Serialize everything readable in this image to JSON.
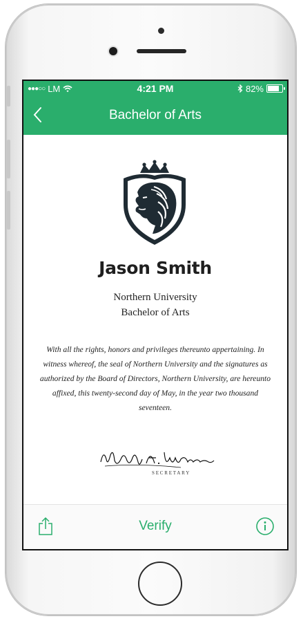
{
  "status_bar": {
    "carrier": "LM",
    "signal_dots": "●●●○○",
    "time": "4:21 PM",
    "battery_percent": "82%",
    "battery_level": 0.82
  },
  "nav": {
    "title": "Bachelor of Arts",
    "back_icon": "chevron-left-icon"
  },
  "certificate": {
    "crest_icon": "lion-shield-crest-icon",
    "recipient_name": "Jason Smith",
    "institution": "Northern University",
    "degree": "Bachelor of Arts",
    "body": "With all the rights, honors and privileges thereunto appertaining. In witness whereof, the seal of Northern University and the signatures as authorized by the Board of Directors, Northern University, are hereunto affixed, this twenty-second day of May, in the year two thousand seventeen.",
    "signer_title": "SECRETARY"
  },
  "toolbar": {
    "share_icon": "share-icon",
    "verify_label": "Verify",
    "info_icon": "info-icon"
  },
  "colors": {
    "accent": "#2aae6c",
    "crest": "#1f2b33"
  }
}
